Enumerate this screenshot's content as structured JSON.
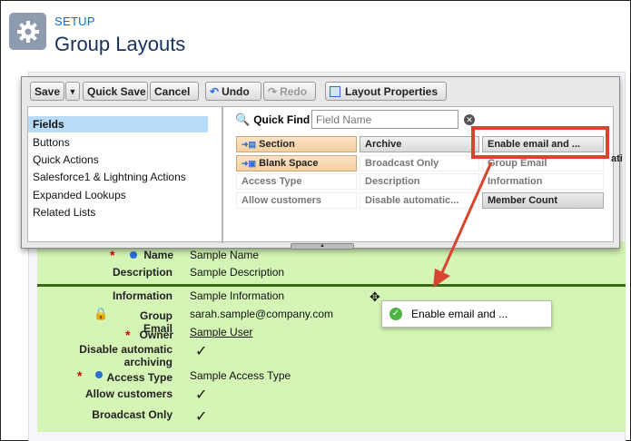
{
  "header": {
    "section_label": "SETUP",
    "title": "Group Layouts",
    "icon": "gear-icon"
  },
  "toolbar": {
    "save": "Save",
    "quick_save": "Quick Save",
    "cancel": "Cancel",
    "undo": "Undo",
    "redo": "Redo",
    "layout_properties": "Layout Properties"
  },
  "categories": [
    "Fields",
    "Buttons",
    "Quick Actions",
    "Salesforce1 & Lightning Actions",
    "Expanded Lookups",
    "Related Lists"
  ],
  "quick_find": {
    "label": "Quick Find",
    "placeholder": "Field Name"
  },
  "palette_fields": {
    "section": "Section",
    "archive": "Archive",
    "enable_email": "Enable email and ...",
    "blank_space": "Blank Space",
    "broadcast_only": "Broadcast Only",
    "group_email": "Group Email",
    "access_type": "Access Type",
    "description": "Description",
    "information": "Information",
    "allow_customers": "Allow customers",
    "disable_automatic": "Disable automatic...",
    "member_count": "Member Count",
    "truncated_col": "ati"
  },
  "layout": {
    "name_label": "Name",
    "name_value": "Sample Name",
    "description_label": "Description",
    "description_value": "Sample Description",
    "information_label": "Information",
    "information_value": "Sample Information",
    "group_email_label": "Group Email",
    "group_email_value": "sarah.sample@company.com",
    "owner_label": "Owner",
    "owner_value": "Sample User",
    "disable_line1": "Disable automatic",
    "disable_line2": "archiving",
    "access_type_label": "Access Type",
    "access_type_value": "Sample Access Type",
    "allow_customers_label": "Allow customers",
    "broadcast_only_label": "Broadcast Only"
  },
  "drag_chip": {
    "label": "Enable email and ..."
  },
  "colors": {
    "highlight": "#d9442e",
    "layout_bg": "#d4f5b5",
    "accent": "#0070d2"
  }
}
